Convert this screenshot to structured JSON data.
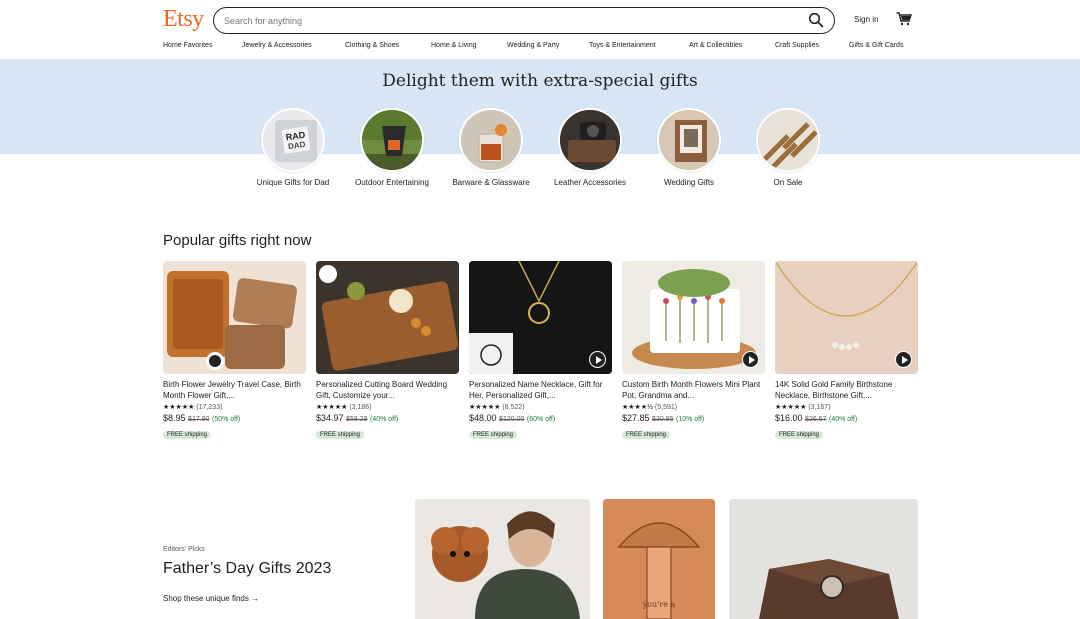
{
  "header": {
    "logo": "Etsy",
    "search_placeholder": "Search for anything",
    "signin": "Sign in"
  },
  "nav": [
    "Home Favorites",
    "Jewelry & Accessories",
    "Clothing & Shoes",
    "Home & Living",
    "Wedding & Party",
    "Toys & Entertainment",
    "Art & Collectibles",
    "Craft Supplies",
    "Gifts & Gift Cards"
  ],
  "hero": {
    "title": "Delight them with extra-special gifts",
    "categories": [
      {
        "label": "Unique Gifts for Dad"
      },
      {
        "label": "Outdoor Entertaining"
      },
      {
        "label": "Barware & Glassware"
      },
      {
        "label": "Leather Accessories"
      },
      {
        "label": "Wedding Gifts"
      },
      {
        "label": "On Sale"
      }
    ]
  },
  "popular": {
    "title": "Popular gifts right now",
    "items": [
      {
        "title": "Birth Flower Jewelry Travel Case, Birth Month Flower Gift,...",
        "stars": "★★★★★",
        "reviews": "(17,233)",
        "price": "$8.95",
        "original": "$17.90",
        "discount": "(50% off)",
        "shipping": "FREE shipping",
        "video": false
      },
      {
        "title": "Personalized Cutting Board Wedding Gift, Customize your...",
        "stars": "★★★★★",
        "reviews": "(3,186)",
        "price": "$34.97",
        "original": "$58.29",
        "discount": "(40% off)",
        "shipping": "FREE shipping",
        "video": false
      },
      {
        "title": "Personalized Name Necklace, Gift for Her, Personalized Gift,...",
        "stars": "★★★★★",
        "reviews": "(8,522)",
        "price": "$48.00",
        "original": "$120.00",
        "discount": "(60% off)",
        "shipping": "FREE shipping",
        "video": true
      },
      {
        "title": "Custom Birth Month Flowers Mini Plant Pot, Grandma and...",
        "stars": "★★★★½",
        "reviews": "(5,591)",
        "price": "$27.85",
        "original": "$30.95",
        "discount": "(10% off)",
        "shipping": "FREE shipping",
        "video": true
      },
      {
        "title": "14K Solid Gold Family Birthstone Necklace, Birthstone Gift,...",
        "stars": "★★★★★",
        "reviews": "(3,167)",
        "price": "$16.00",
        "original": "$26.67",
        "discount": "(40% off)",
        "shipping": "FREE shipping",
        "video": true
      }
    ]
  },
  "editors": {
    "kicker": "Editors' Picks",
    "title": "Father’s Day Gifts 2023",
    "link": "Shop these unique finds"
  },
  "colors": {
    "brand": "#f1641e",
    "hero_bg": "#d7e6f5",
    "free_badge": "#d4e9d6",
    "discount": "#1e7a3c"
  }
}
